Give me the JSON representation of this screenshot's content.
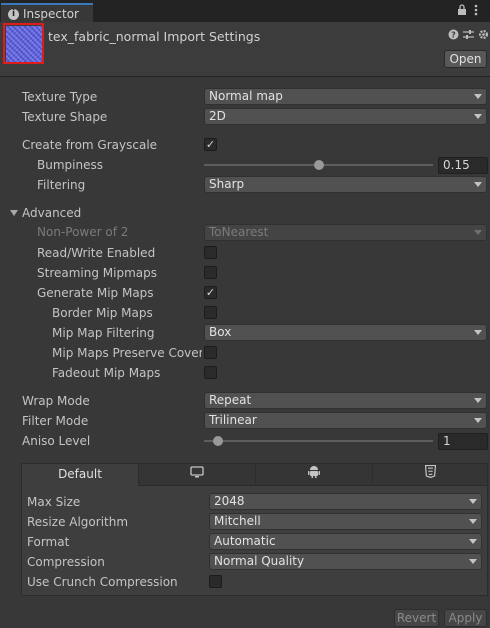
{
  "tab": {
    "title": "Inspector",
    "info_icon_glyph": "i"
  },
  "header": {
    "title": "tex_fabric_normal Import Settings",
    "open_label": "Open"
  },
  "texture_type": {
    "label": "Texture Type",
    "value": "Normal map"
  },
  "texture_shape": {
    "label": "Texture Shape",
    "value": "2D"
  },
  "create_from_grayscale": {
    "label": "Create from Grayscale",
    "checked": true
  },
  "bumpiness": {
    "label": "Bumpiness",
    "value": "0.15",
    "fraction": 0.5
  },
  "filtering": {
    "label": "Filtering",
    "value": "Sharp"
  },
  "advanced": {
    "label": "Advanced",
    "non_power_of_2": {
      "label": "Non-Power of 2",
      "value": "ToNearest"
    },
    "read_write": {
      "label": "Read/Write Enabled",
      "checked": false
    },
    "streaming_mipmaps": {
      "label": "Streaming Mipmaps",
      "checked": false
    },
    "generate_mip_maps": {
      "label": "Generate Mip Maps",
      "checked": true
    },
    "border_mip_maps": {
      "label": "Border Mip Maps",
      "checked": false
    },
    "mip_map_filtering": {
      "label": "Mip Map Filtering",
      "value": "Box"
    },
    "preserve_coverage": {
      "label": "Mip Maps Preserve Covera",
      "checked": false
    },
    "fadeout_mip_maps": {
      "label": "Fadeout Mip Maps",
      "checked": false
    }
  },
  "wrap_mode": {
    "label": "Wrap Mode",
    "value": "Repeat"
  },
  "filter_mode": {
    "label": "Filter Mode",
    "value": "Trilinear"
  },
  "aniso_level": {
    "label": "Aniso Level",
    "value": "1",
    "fraction": 0.0625
  },
  "platform_tabs": [
    {
      "label": "Default",
      "icon": null
    },
    {
      "label": "",
      "icon": "monitor-icon"
    },
    {
      "label": "",
      "icon": "android-icon"
    },
    {
      "label": "",
      "icon": "html5-icon"
    }
  ],
  "platform": {
    "max_size": {
      "label": "Max Size",
      "value": "2048"
    },
    "resize_algorithm": {
      "label": "Resize Algorithm",
      "value": "Mitchell"
    },
    "format": {
      "label": "Format",
      "value": "Automatic"
    },
    "compression": {
      "label": "Compression",
      "value": "Normal Quality"
    },
    "crunch": {
      "label": "Use Crunch Compression",
      "checked": false
    }
  },
  "footer": {
    "revert_label": "Revert",
    "apply_label": "Apply"
  },
  "check_glyph": "✓",
  "colors": {
    "accent": "#3a79bb",
    "highlight_outline": "#e01b1b",
    "normal_map_blue": "#6a6ee8"
  }
}
